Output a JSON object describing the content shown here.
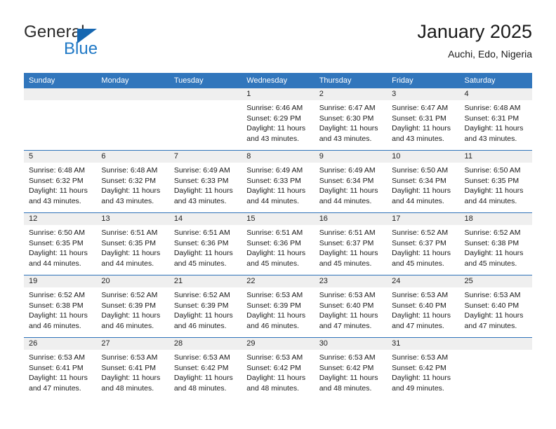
{
  "brand": {
    "word_top": "General",
    "word_bottom": "Blue",
    "triangle_icon": "blue-triangle-icon",
    "accent_color": "#2079c6"
  },
  "header": {
    "title": "January 2025",
    "subtitle": "Auchi, Edo, Nigeria"
  },
  "theme": {
    "header_row_bg": "#3176bc",
    "week_separator": "#2f73b9",
    "day_band_bg": "#efefef"
  },
  "weekdays": [
    "Sunday",
    "Monday",
    "Tuesday",
    "Wednesday",
    "Thursday",
    "Friday",
    "Saturday"
  ],
  "labels": {
    "sunrise_prefix": "Sunrise:",
    "sunset_prefix": "Sunset:",
    "daylight_prefix": "Daylight:"
  },
  "weeks": [
    [
      {
        "day": "",
        "empty": true,
        "l1": "",
        "l2": "",
        "l3": "",
        "l4": ""
      },
      {
        "day": "",
        "empty": true,
        "l1": "",
        "l2": "",
        "l3": "",
        "l4": ""
      },
      {
        "day": "",
        "empty": true,
        "l1": "",
        "l2": "",
        "l3": "",
        "l4": ""
      },
      {
        "day": "1",
        "empty": false,
        "l1": "Sunrise: 6:46 AM",
        "l2": "Sunset: 6:29 PM",
        "l3": "Daylight: 11 hours",
        "l4": "and 43 minutes."
      },
      {
        "day": "2",
        "empty": false,
        "l1": "Sunrise: 6:47 AM",
        "l2": "Sunset: 6:30 PM",
        "l3": "Daylight: 11 hours",
        "l4": "and 43 minutes."
      },
      {
        "day": "3",
        "empty": false,
        "l1": "Sunrise: 6:47 AM",
        "l2": "Sunset: 6:31 PM",
        "l3": "Daylight: 11 hours",
        "l4": "and 43 minutes."
      },
      {
        "day": "4",
        "empty": false,
        "l1": "Sunrise: 6:48 AM",
        "l2": "Sunset: 6:31 PM",
        "l3": "Daylight: 11 hours",
        "l4": "and 43 minutes."
      }
    ],
    [
      {
        "day": "5",
        "empty": false,
        "l1": "Sunrise: 6:48 AM",
        "l2": "Sunset: 6:32 PM",
        "l3": "Daylight: 11 hours",
        "l4": "and 43 minutes."
      },
      {
        "day": "6",
        "empty": false,
        "l1": "Sunrise: 6:48 AM",
        "l2": "Sunset: 6:32 PM",
        "l3": "Daylight: 11 hours",
        "l4": "and 43 minutes."
      },
      {
        "day": "7",
        "empty": false,
        "l1": "Sunrise: 6:49 AM",
        "l2": "Sunset: 6:33 PM",
        "l3": "Daylight: 11 hours",
        "l4": "and 43 minutes."
      },
      {
        "day": "8",
        "empty": false,
        "l1": "Sunrise: 6:49 AM",
        "l2": "Sunset: 6:33 PM",
        "l3": "Daylight: 11 hours",
        "l4": "and 44 minutes."
      },
      {
        "day": "9",
        "empty": false,
        "l1": "Sunrise: 6:49 AM",
        "l2": "Sunset: 6:34 PM",
        "l3": "Daylight: 11 hours",
        "l4": "and 44 minutes."
      },
      {
        "day": "10",
        "empty": false,
        "l1": "Sunrise: 6:50 AM",
        "l2": "Sunset: 6:34 PM",
        "l3": "Daylight: 11 hours",
        "l4": "and 44 minutes."
      },
      {
        "day": "11",
        "empty": false,
        "l1": "Sunrise: 6:50 AM",
        "l2": "Sunset: 6:35 PM",
        "l3": "Daylight: 11 hours",
        "l4": "and 44 minutes."
      }
    ],
    [
      {
        "day": "12",
        "empty": false,
        "l1": "Sunrise: 6:50 AM",
        "l2": "Sunset: 6:35 PM",
        "l3": "Daylight: 11 hours",
        "l4": "and 44 minutes."
      },
      {
        "day": "13",
        "empty": false,
        "l1": "Sunrise: 6:51 AM",
        "l2": "Sunset: 6:35 PM",
        "l3": "Daylight: 11 hours",
        "l4": "and 44 minutes."
      },
      {
        "day": "14",
        "empty": false,
        "l1": "Sunrise: 6:51 AM",
        "l2": "Sunset: 6:36 PM",
        "l3": "Daylight: 11 hours",
        "l4": "and 45 minutes."
      },
      {
        "day": "15",
        "empty": false,
        "l1": "Sunrise: 6:51 AM",
        "l2": "Sunset: 6:36 PM",
        "l3": "Daylight: 11 hours",
        "l4": "and 45 minutes."
      },
      {
        "day": "16",
        "empty": false,
        "l1": "Sunrise: 6:51 AM",
        "l2": "Sunset: 6:37 PM",
        "l3": "Daylight: 11 hours",
        "l4": "and 45 minutes."
      },
      {
        "day": "17",
        "empty": false,
        "l1": "Sunrise: 6:52 AM",
        "l2": "Sunset: 6:37 PM",
        "l3": "Daylight: 11 hours",
        "l4": "and 45 minutes."
      },
      {
        "day": "18",
        "empty": false,
        "l1": "Sunrise: 6:52 AM",
        "l2": "Sunset: 6:38 PM",
        "l3": "Daylight: 11 hours",
        "l4": "and 45 minutes."
      }
    ],
    [
      {
        "day": "19",
        "empty": false,
        "l1": "Sunrise: 6:52 AM",
        "l2": "Sunset: 6:38 PM",
        "l3": "Daylight: 11 hours",
        "l4": "and 46 minutes."
      },
      {
        "day": "20",
        "empty": false,
        "l1": "Sunrise: 6:52 AM",
        "l2": "Sunset: 6:39 PM",
        "l3": "Daylight: 11 hours",
        "l4": "and 46 minutes."
      },
      {
        "day": "21",
        "empty": false,
        "l1": "Sunrise: 6:52 AM",
        "l2": "Sunset: 6:39 PM",
        "l3": "Daylight: 11 hours",
        "l4": "and 46 minutes."
      },
      {
        "day": "22",
        "empty": false,
        "l1": "Sunrise: 6:53 AM",
        "l2": "Sunset: 6:39 PM",
        "l3": "Daylight: 11 hours",
        "l4": "and 46 minutes."
      },
      {
        "day": "23",
        "empty": false,
        "l1": "Sunrise: 6:53 AM",
        "l2": "Sunset: 6:40 PM",
        "l3": "Daylight: 11 hours",
        "l4": "and 47 minutes."
      },
      {
        "day": "24",
        "empty": false,
        "l1": "Sunrise: 6:53 AM",
        "l2": "Sunset: 6:40 PM",
        "l3": "Daylight: 11 hours",
        "l4": "and 47 minutes."
      },
      {
        "day": "25",
        "empty": false,
        "l1": "Sunrise: 6:53 AM",
        "l2": "Sunset: 6:40 PM",
        "l3": "Daylight: 11 hours",
        "l4": "and 47 minutes."
      }
    ],
    [
      {
        "day": "26",
        "empty": false,
        "l1": "Sunrise: 6:53 AM",
        "l2": "Sunset: 6:41 PM",
        "l3": "Daylight: 11 hours",
        "l4": "and 47 minutes."
      },
      {
        "day": "27",
        "empty": false,
        "l1": "Sunrise: 6:53 AM",
        "l2": "Sunset: 6:41 PM",
        "l3": "Daylight: 11 hours",
        "l4": "and 48 minutes."
      },
      {
        "day": "28",
        "empty": false,
        "l1": "Sunrise: 6:53 AM",
        "l2": "Sunset: 6:42 PM",
        "l3": "Daylight: 11 hours",
        "l4": "and 48 minutes."
      },
      {
        "day": "29",
        "empty": false,
        "l1": "Sunrise: 6:53 AM",
        "l2": "Sunset: 6:42 PM",
        "l3": "Daylight: 11 hours",
        "l4": "and 48 minutes."
      },
      {
        "day": "30",
        "empty": false,
        "l1": "Sunrise: 6:53 AM",
        "l2": "Sunset: 6:42 PM",
        "l3": "Daylight: 11 hours",
        "l4": "and 48 minutes."
      },
      {
        "day": "31",
        "empty": false,
        "l1": "Sunrise: 6:53 AM",
        "l2": "Sunset: 6:42 PM",
        "l3": "Daylight: 11 hours",
        "l4": "and 49 minutes."
      },
      {
        "day": "",
        "empty": true,
        "l1": "",
        "l2": "",
        "l3": "",
        "l4": ""
      }
    ]
  ]
}
